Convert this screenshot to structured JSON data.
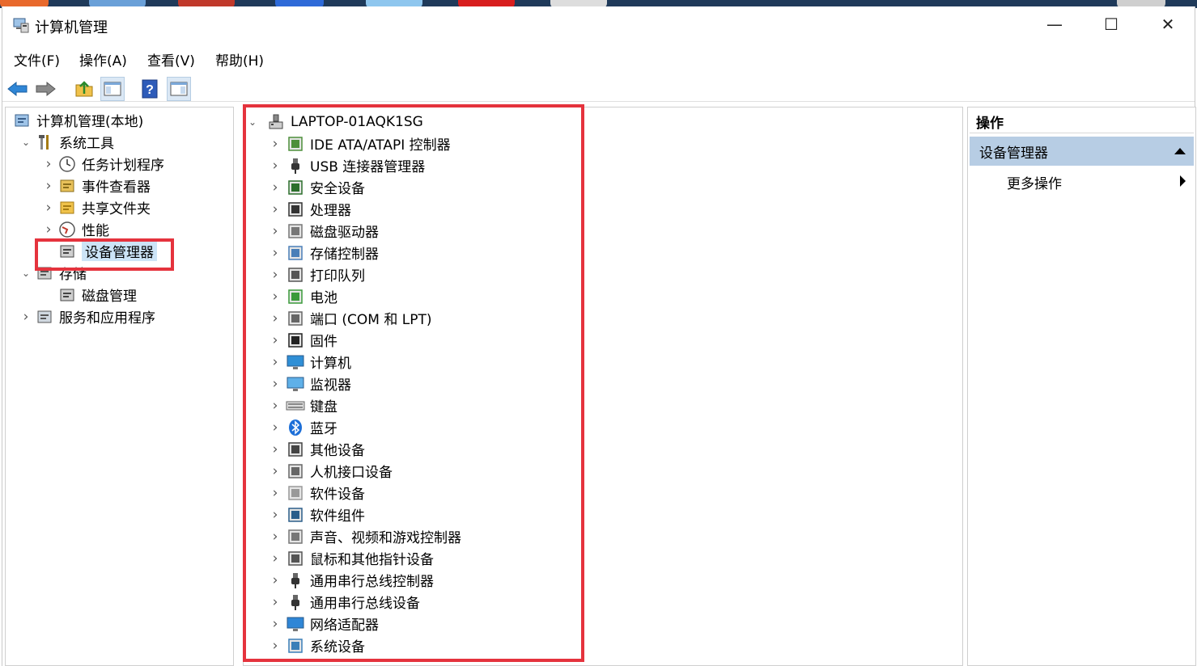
{
  "window": {
    "title": "计算机管理",
    "minimize": "—",
    "maximize": "☐",
    "close": "✕"
  },
  "menu": [
    "文件(F)",
    "操作(A)",
    "查看(V)",
    "帮助(H)"
  ],
  "left_tree": [
    {
      "label": "计算机管理(本地)",
      "level": 0,
      "chevron": "",
      "icon": "computer-management-icon"
    },
    {
      "label": "系统工具",
      "level": 1,
      "chevron": "v",
      "icon": "tools-icon"
    },
    {
      "label": "任务计划程序",
      "level": 2,
      "chevron": ">",
      "icon": "clock-icon"
    },
    {
      "label": "事件查看器",
      "level": 2,
      "chevron": ">",
      "icon": "event-viewer-icon"
    },
    {
      "label": "共享文件夹",
      "level": 2,
      "chevron": ">",
      "icon": "shared-folder-icon"
    },
    {
      "label": "性能",
      "level": 2,
      "chevron": ">",
      "icon": "performance-icon"
    },
    {
      "label": "设备管理器",
      "level": 2,
      "chevron": "",
      "icon": "device-manager-icon"
    },
    {
      "label": "存储",
      "level": 1,
      "chevron": "v",
      "icon": "storage-icon"
    },
    {
      "label": "磁盘管理",
      "level": 2,
      "chevron": "",
      "icon": "disk-management-icon"
    },
    {
      "label": "服务和应用程序",
      "level": 1,
      "chevron": ">",
      "icon": "services-icon"
    }
  ],
  "device_root": "LAPTOP-01AQK1SG",
  "devices": [
    {
      "label": "IDE ATA/ATAPI 控制器",
      "icon": "ide-controller-icon"
    },
    {
      "label": "USB 连接器管理器",
      "icon": "usb-connector-icon"
    },
    {
      "label": "安全设备",
      "icon": "security-device-icon"
    },
    {
      "label": "处理器",
      "icon": "processor-icon"
    },
    {
      "label": "磁盘驱动器",
      "icon": "disk-drive-icon"
    },
    {
      "label": "存储控制器",
      "icon": "storage-controller-icon"
    },
    {
      "label": "打印队列",
      "icon": "printer-icon"
    },
    {
      "label": "电池",
      "icon": "battery-icon"
    },
    {
      "label": "端口 (COM 和 LPT)",
      "icon": "port-icon"
    },
    {
      "label": "固件",
      "icon": "firmware-icon"
    },
    {
      "label": "计算机",
      "icon": "computer-icon"
    },
    {
      "label": "监视器",
      "icon": "monitor-icon"
    },
    {
      "label": "键盘",
      "icon": "keyboard-icon"
    },
    {
      "label": "蓝牙",
      "icon": "bluetooth-icon"
    },
    {
      "label": "其他设备",
      "icon": "other-devices-icon"
    },
    {
      "label": "人机接口设备",
      "icon": "hid-icon"
    },
    {
      "label": "软件设备",
      "icon": "software-device-icon"
    },
    {
      "label": "软件组件",
      "icon": "software-component-icon"
    },
    {
      "label": "声音、视频和游戏控制器",
      "icon": "sound-icon"
    },
    {
      "label": "鼠标和其他指针设备",
      "icon": "mouse-icon"
    },
    {
      "label": "通用串行总线控制器",
      "icon": "usb-controller-icon"
    },
    {
      "label": "通用串行总线设备",
      "icon": "usb-device-icon"
    },
    {
      "label": "网络适配器",
      "icon": "network-adapter-icon"
    },
    {
      "label": "系统设备",
      "icon": "system-device-icon"
    }
  ],
  "actions": {
    "header": "操作",
    "section": "设备管理器",
    "more": "更多操作"
  },
  "colors": {
    "highlight_box": "#e5333d",
    "selection": "#cce4f7",
    "actions_section": "#b7cde4"
  }
}
